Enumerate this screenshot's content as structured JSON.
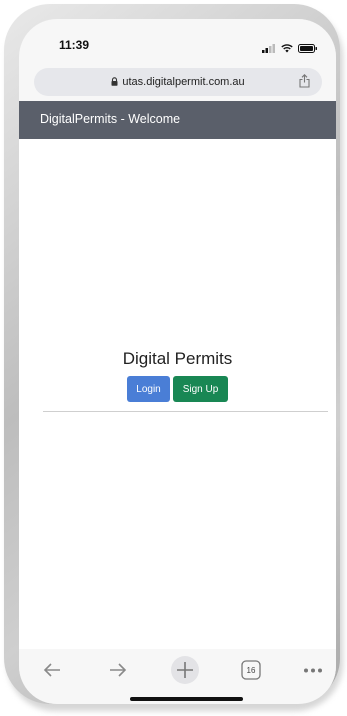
{
  "status_bar": {
    "time": "11:39"
  },
  "browser": {
    "url": "utas.digitalpermit.com.au",
    "tab_count": "16"
  },
  "app_header": {
    "title": "DigitalPermits - Welcome"
  },
  "main": {
    "title": "Digital Permits",
    "login_label": "Login",
    "signup_label": "Sign Up"
  },
  "colors": {
    "header_bg": "#5a5f6a",
    "login_button": "#4a7ed6",
    "signup_button": "#198754"
  },
  "icons": {
    "status": [
      "signal-icon",
      "wifi-icon",
      "battery-icon"
    ],
    "url_bar": [
      "lock-icon",
      "share-icon"
    ],
    "bottom_toolbar": [
      "back-arrow-icon",
      "forward-arrow-icon",
      "new-tab-plus-icon",
      "tabs-icon",
      "more-icon"
    ]
  }
}
